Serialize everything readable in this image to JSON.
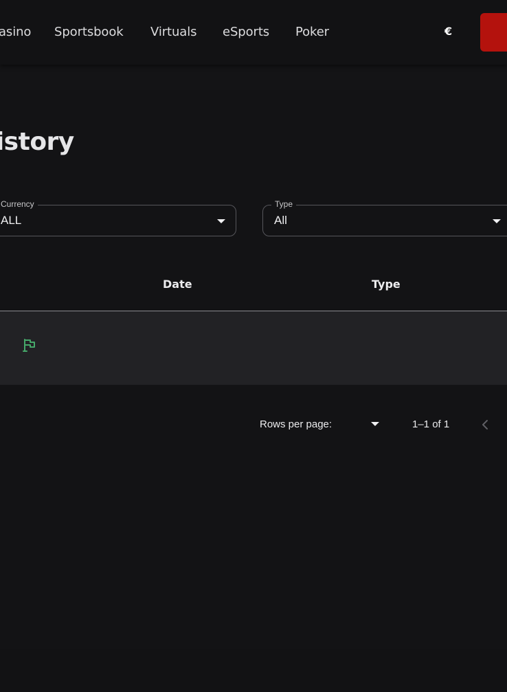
{
  "header": {
    "nav": [
      {
        "label": "asino"
      },
      {
        "label": "Sportsbook"
      },
      {
        "label": "Virtuals"
      },
      {
        "label": "eSports"
      },
      {
        "label": "Poker"
      }
    ],
    "currency_symbol": "€",
    "accent_color": "#b4120d"
  },
  "main": {
    "title": "listory",
    "filters": {
      "currency": {
        "label": "Currency",
        "value": "ALL"
      },
      "type": {
        "label": "Type",
        "value": "All"
      }
    },
    "table": {
      "columns": [
        "Date",
        "Type"
      ],
      "rows": [
        {
          "status_icon": "flag-icon",
          "status_color": "#46a86a"
        }
      ]
    },
    "pagination": {
      "rows_per_page_label": "Rows per page:",
      "range_label": "1–1 of 1"
    }
  }
}
